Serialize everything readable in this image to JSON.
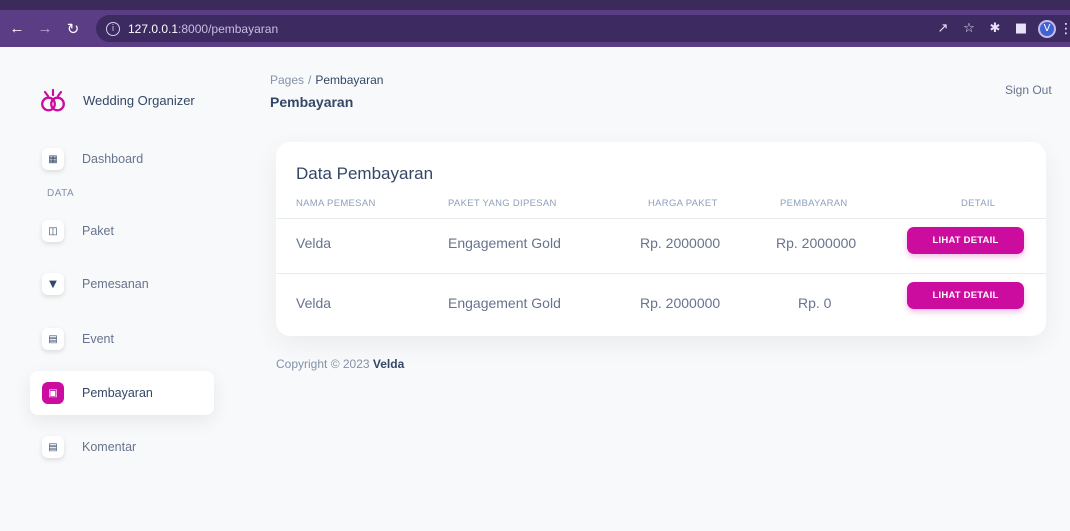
{
  "browser": {
    "url_host": "127.0.0.1",
    "url_path": ":8000/pembayaran",
    "profile_initial": "V"
  },
  "sidebar": {
    "brand_name": "Wedding Organizer",
    "section_heading": "DATA",
    "items": [
      {
        "label": "Dashboard",
        "icon": "shop-icon"
      },
      {
        "label": "Paket",
        "icon": "chart-bar-icon"
      },
      {
        "label": "Pemesanan",
        "icon": "cart-icon"
      },
      {
        "label": "Event",
        "icon": "calendar-icon"
      },
      {
        "label": "Pembayaran",
        "icon": "payment-icon",
        "active": true
      },
      {
        "label": "Komentar",
        "icon": "calendar-icon"
      }
    ]
  },
  "header": {
    "breadcrumb_root": "Pages",
    "breadcrumb_separator": "/",
    "breadcrumb_current": "Pembayaran",
    "title": "Pembayaran",
    "sign_out": "Sign Out"
  },
  "table": {
    "title": "Data Pembayaran",
    "columns": [
      "NAMA PEMESAN",
      "PAKET YANG DIPESAN",
      "HARGA PAKET",
      "PEMBAYARAN",
      "DETAIL"
    ],
    "rows": [
      {
        "nama": "Velda",
        "paket": "Engagement Gold",
        "harga": "Rp. 2000000",
        "pembayaran": "Rp. 2000000",
        "action": "LIHAT DETAIL"
      },
      {
        "nama": "Velda",
        "paket": "Engagement Gold",
        "harga": "Rp. 2000000",
        "pembayaran": "Rp. 0",
        "action": "LIHAT DETAIL"
      }
    ]
  },
  "footer": {
    "copyright": "Copyright © 2023",
    "author": "Velda"
  },
  "colors": {
    "accent": "#cb0c9f",
    "browser_toolbar": "#5b3d86",
    "text_primary": "#344767",
    "text_secondary": "#67748e"
  }
}
